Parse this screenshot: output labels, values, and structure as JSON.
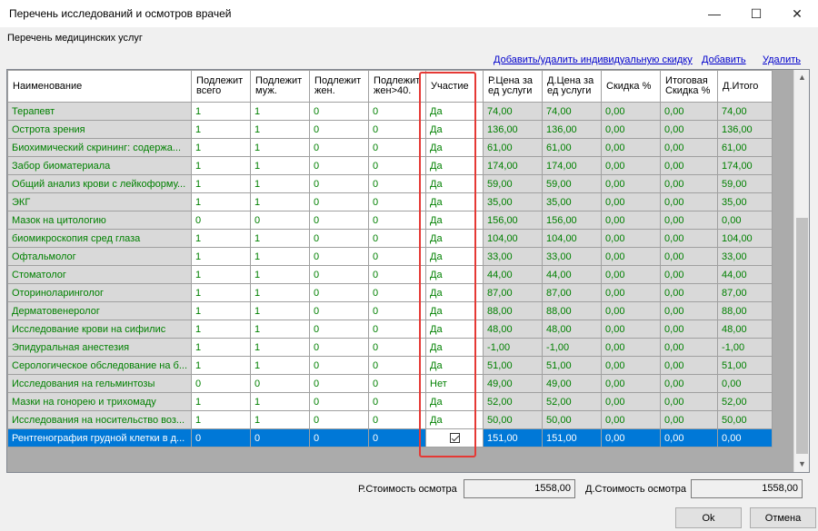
{
  "window": {
    "title": "Перечень исследований и осмотров врачей",
    "minimize": "—",
    "maximize": "☐",
    "close": "✕"
  },
  "subtitle": "Перечень медицинских услуг",
  "links": {
    "discount": "Добавить/удалить индивидуальную скидку",
    "add": "Добавить",
    "delete": "Удалить"
  },
  "table": {
    "headers": [
      "Наименование",
      "Подлежит всего",
      "Подлежит муж.",
      "Подлежит жен.",
      "Подлежит жен>40.",
      "Участие",
      "Р.Цена за ед услуги",
      "Д.Цена за ед услуги",
      "Скидка %",
      "Итоговая Скидка %",
      "Д.Итого"
    ],
    "rows": [
      [
        "Терапевт",
        "1",
        "1",
        "0",
        "0",
        "Да",
        "74,00",
        "74,00",
        "0,00",
        "0,00",
        "74,00"
      ],
      [
        "Острота зрения",
        "1",
        "1",
        "0",
        "0",
        "Да",
        "136,00",
        "136,00",
        "0,00",
        "0,00",
        "136,00"
      ],
      [
        "Биохимический скрининг: содержа...",
        "1",
        "1",
        "0",
        "0",
        "Да",
        "61,00",
        "61,00",
        "0,00",
        "0,00",
        "61,00"
      ],
      [
        "Забор биоматериала",
        "1",
        "1",
        "0",
        "0",
        "Да",
        "174,00",
        "174,00",
        "0,00",
        "0,00",
        "174,00"
      ],
      [
        "Общий анализ крови с лейкоформу...",
        "1",
        "1",
        "0",
        "0",
        "Да",
        "59,00",
        "59,00",
        "0,00",
        "0,00",
        "59,00"
      ],
      [
        "ЭКГ",
        "1",
        "1",
        "0",
        "0",
        "Да",
        "35,00",
        "35,00",
        "0,00",
        "0,00",
        "35,00"
      ],
      [
        "Мазок на цитологию",
        "0",
        "0",
        "0",
        "0",
        "Да",
        "156,00",
        "156,00",
        "0,00",
        "0,00",
        "0,00"
      ],
      [
        "биомикроскопия сред глаза",
        "1",
        "1",
        "0",
        "0",
        "Да",
        "104,00",
        "104,00",
        "0,00",
        "0,00",
        "104,00"
      ],
      [
        "Офтальмолог",
        "1",
        "1",
        "0",
        "0",
        "Да",
        "33,00",
        "33,00",
        "0,00",
        "0,00",
        "33,00"
      ],
      [
        "Стоматолог",
        "1",
        "1",
        "0",
        "0",
        "Да",
        "44,00",
        "44,00",
        "0,00",
        "0,00",
        "44,00"
      ],
      [
        "Оториноларинголог",
        "1",
        "1",
        "0",
        "0",
        "Да",
        "87,00",
        "87,00",
        "0,00",
        "0,00",
        "87,00"
      ],
      [
        "Дерматовенеролог",
        "1",
        "1",
        "0",
        "0",
        "Да",
        "88,00",
        "88,00",
        "0,00",
        "0,00",
        "88,00"
      ],
      [
        "Исследование крови на сифилис",
        "1",
        "1",
        "0",
        "0",
        "Да",
        "48,00",
        "48,00",
        "0,00",
        "0,00",
        "48,00"
      ],
      [
        "Эпидуральная анестезия",
        "1",
        "1",
        "0",
        "0",
        "Да",
        "-1,00",
        "-1,00",
        "0,00",
        "0,00",
        "-1,00"
      ],
      [
        "Серологическое обследование на б...",
        "1",
        "1",
        "0",
        "0",
        "Да",
        "51,00",
        "51,00",
        "0,00",
        "0,00",
        "51,00"
      ],
      [
        "Исследования на гельминтозы",
        "0",
        "0",
        "0",
        "0",
        "Нет",
        "49,00",
        "49,00",
        "0,00",
        "0,00",
        "0,00"
      ],
      [
        "Мазки на гонорею и трихомаду",
        "1",
        "1",
        "0",
        "0",
        "Да",
        "52,00",
        "52,00",
        "0,00",
        "0,00",
        "52,00"
      ],
      [
        "Исследования на носительство воз...",
        "1",
        "1",
        "0",
        "0",
        "Да",
        "50,00",
        "50,00",
        "0,00",
        "0,00",
        "50,00"
      ]
    ],
    "selected_row": [
      "Рентгенография грудной клетки в д...",
      "0",
      "0",
      "0",
      "0",
      "",
      "151,00",
      "151,00",
      "0,00",
      "0,00",
      "0,00"
    ]
  },
  "footer": {
    "r_cost_label": "Р.Стоимость осмотра",
    "r_cost_value": "1558,00",
    "d_cost_label": "Д.Стоимость осмотра",
    "d_cost_value": "1558,00"
  },
  "buttons": {
    "ok": "Ok",
    "cancel": "Отмена"
  }
}
